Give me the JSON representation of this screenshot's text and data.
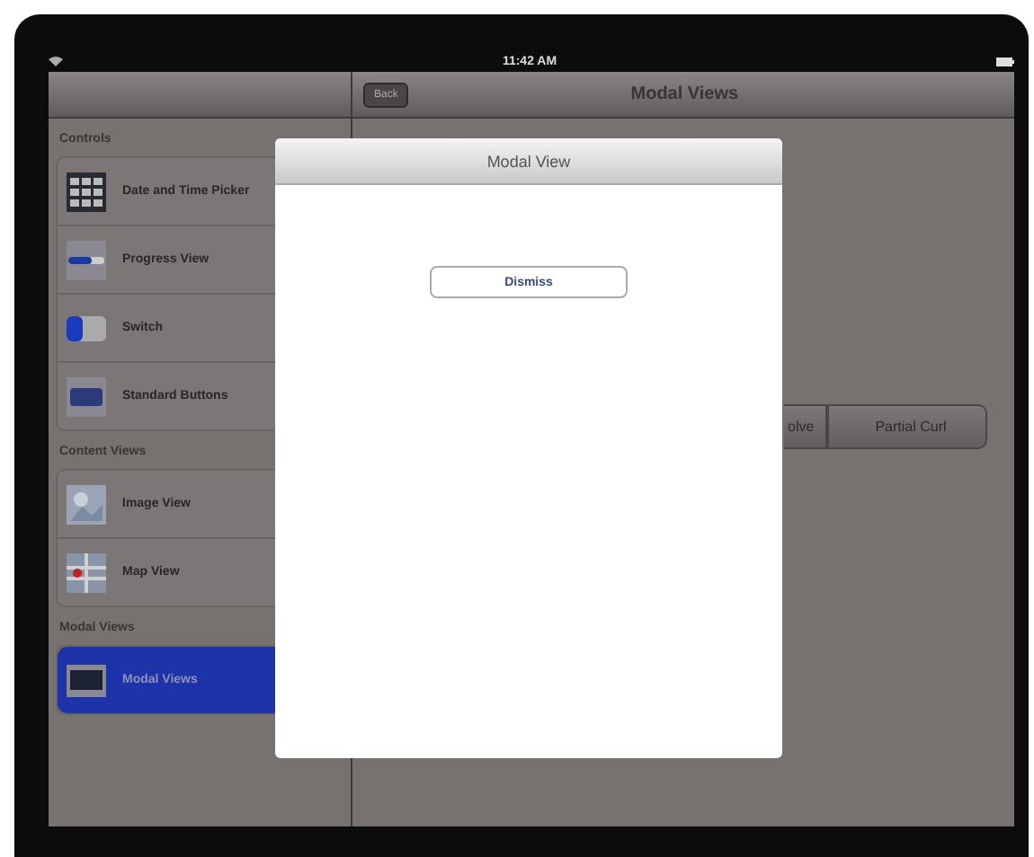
{
  "status_bar": {
    "time": "11:42 AM"
  },
  "sidebar": {
    "groups": [
      {
        "title": "Controls",
        "items": [
          {
            "label": "Date and Time Picker",
            "selected": false
          },
          {
            "label": "Progress View",
            "selected": false
          },
          {
            "label": "Switch",
            "selected": false
          },
          {
            "label": "Standard Buttons",
            "selected": false
          }
        ]
      },
      {
        "title": "Content Views",
        "items": [
          {
            "label": "Image View",
            "selected": false
          },
          {
            "label": "Map View",
            "selected": false
          }
        ]
      },
      {
        "title": "Modal Views",
        "items": [
          {
            "label": "Modal Views",
            "selected": true
          }
        ]
      }
    ]
  },
  "detail": {
    "back_button": "Back",
    "title": "Modal Views",
    "segments": [
      {
        "label": "olve",
        "selected": false
      },
      {
        "label": "Partial Curl",
        "selected": false
      }
    ]
  },
  "modal": {
    "title": "Modal View",
    "button": "Dismiss"
  }
}
